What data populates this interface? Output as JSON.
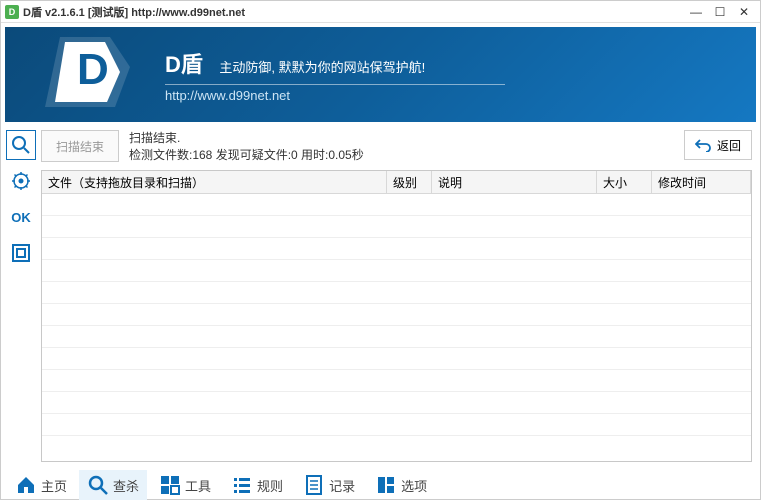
{
  "titlebar": {
    "title": "D盾 v2.1.6.1 [测试版] http://www.d99net.net"
  },
  "banner": {
    "name": "D盾",
    "slogan": "主动防御, 默默为你的网站保驾护航!",
    "url": "http://www.d99net.net"
  },
  "sidebar": {
    "ok_label": "OK"
  },
  "toolbar": {
    "scan_button": "扫描结束",
    "status_line1": "扫描结束.",
    "status_line2": "检测文件数:168 发现可疑文件:0 用时:0.05秒",
    "return_button": "返回"
  },
  "table": {
    "headers": {
      "file": "文件（支持拖放目录和扫描）",
      "level": "级别",
      "desc": "说明",
      "size": "大小",
      "mtime": "修改时间"
    }
  },
  "nav": {
    "home": "主页",
    "scan": "查杀",
    "tools": "工具",
    "rules": "规则",
    "log": "记录",
    "options": "选项"
  },
  "colors": {
    "accent": "#0e6fb8"
  }
}
